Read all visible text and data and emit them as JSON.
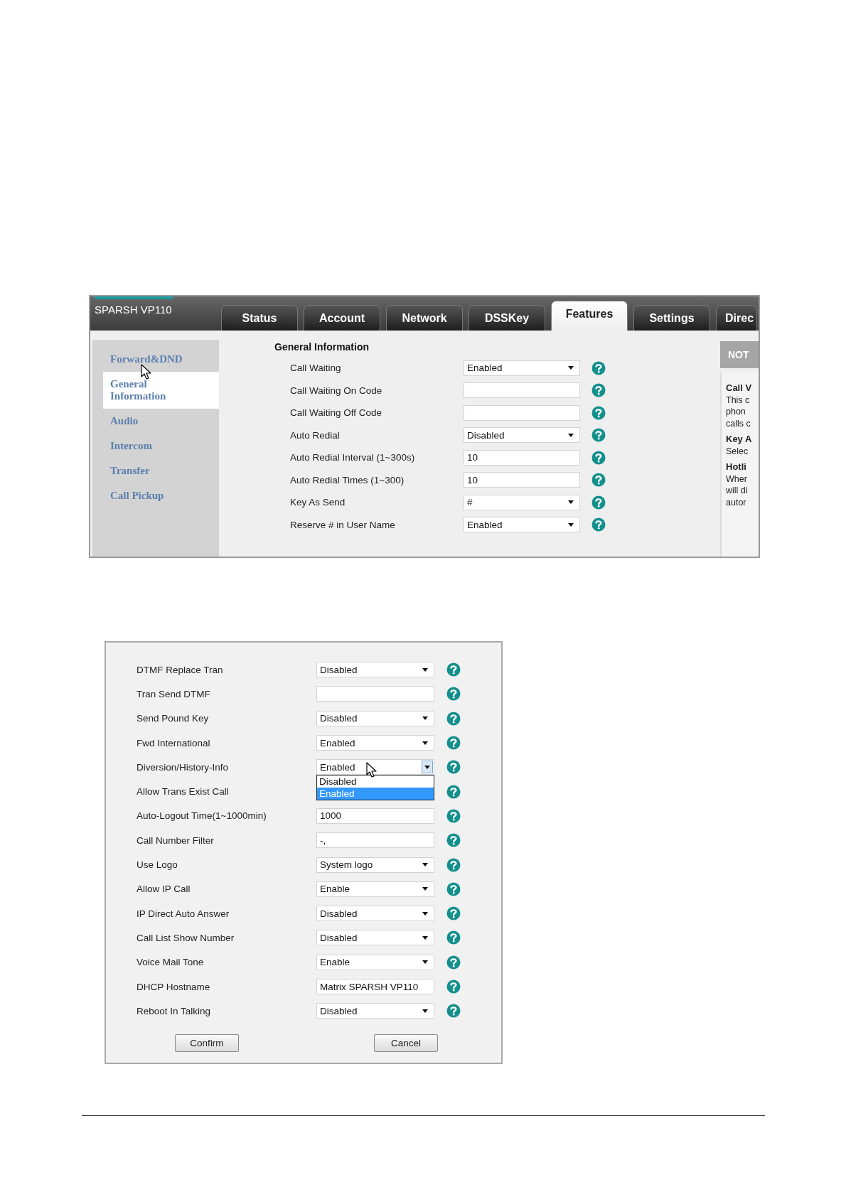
{
  "screen1": {
    "model": "SPARSH VP110",
    "tabs": [
      {
        "label": "Status",
        "selected": false
      },
      {
        "label": "Account",
        "selected": false
      },
      {
        "label": "Network",
        "selected": false
      },
      {
        "label": "DSSKey",
        "selected": false
      },
      {
        "label": "Features",
        "selected": true
      },
      {
        "label": "Settings",
        "selected": false
      },
      {
        "label": "Direc",
        "selected": false
      }
    ],
    "sidebar": [
      {
        "label": "Forward&DND",
        "selected": false
      },
      {
        "label": "General Information",
        "selected": true
      },
      {
        "label": "Audio",
        "selected": false
      },
      {
        "label": "Intercom",
        "selected": false
      },
      {
        "label": "Transfer",
        "selected": false
      },
      {
        "label": "Call Pickup",
        "selected": false
      }
    ],
    "section_title": "General Information",
    "rows": [
      {
        "label": "Call Waiting",
        "kind": "select",
        "value": "Enabled",
        "expanded": false
      },
      {
        "label": "Call Waiting On Code",
        "kind": "input"
      },
      {
        "label": "Call Waiting Off Code",
        "kind": "input"
      },
      {
        "label": "Auto Redial",
        "kind": "select",
        "value": "Disabled",
        "expanded": false
      },
      {
        "label": "Auto Redial Interval (1~300s)",
        "kind": "input",
        "value": "10"
      },
      {
        "label": "Auto Redial Times (1~300)",
        "kind": "input",
        "value": "10"
      },
      {
        "label": "Key As Send",
        "kind": "select",
        "value": "#",
        "expanded": false
      },
      {
        "label": "Reserve # in User Name",
        "kind": "select",
        "value": "Enabled",
        "expanded": false
      }
    ],
    "notes": {
      "header": "NOT",
      "lines": [
        {
          "text": "Call V",
          "kind": "heading"
        },
        {
          "text": "This c",
          "kind": "body"
        },
        {
          "text": "phon",
          "kind": "body"
        },
        {
          "text": "calls c",
          "kind": "body"
        },
        {
          "text": "Key A",
          "kind": "heading"
        },
        {
          "text": "Selec",
          "kind": "body"
        },
        {
          "text": "Hotli",
          "kind": "heading"
        },
        {
          "text": "Wher",
          "kind": "body"
        },
        {
          "text": "will di",
          "kind": "body"
        },
        {
          "text": "autor",
          "kind": "body"
        }
      ]
    }
  },
  "screen2": {
    "rows": [
      {
        "label": "DTMF Replace Tran",
        "kind": "select",
        "value": "Disabled",
        "expanded": false
      },
      {
        "label": "Tran Send DTMF",
        "kind": "input"
      },
      {
        "label": "Send Pound Key",
        "kind": "select",
        "value": "Disabled",
        "expanded": false
      },
      {
        "label": "Fwd International",
        "kind": "select",
        "value": "Enabled",
        "expanded": false
      },
      {
        "label": "Diversion/History-Info",
        "kind": "select",
        "value": "Enabled",
        "expanded": true,
        "options": [
          {
            "label": "Disabled",
            "selected": false
          },
          {
            "label": "Enabled",
            "selected": true
          }
        ]
      },
      {
        "label": "Allow Trans Exist Call"
      },
      {
        "label": "Auto-Logout Time(1~1000min)",
        "kind": "input",
        "value": "1000"
      },
      {
        "label": "Call Number Filter",
        "kind": "input",
        "value": "-,"
      },
      {
        "label": "Use Logo",
        "kind": "select",
        "value": "System logo",
        "expanded": false
      },
      {
        "label": "Allow IP Call",
        "kind": "select",
        "value": "Enable",
        "expanded": false
      },
      {
        "label": "IP Direct Auto Answer",
        "kind": "select",
        "value": "Disabled",
        "expanded": false
      },
      {
        "label": "Call List Show Number",
        "kind": "select",
        "value": "Disabled",
        "expanded": false
      },
      {
        "label": "Voice Mail Tone",
        "kind": "select",
        "value": "Enable",
        "expanded": false
      },
      {
        "label": "DHCP Hostname",
        "kind": "input",
        "value": "Matrix SPARSH VP110"
      },
      {
        "label": "Reboot In Talking",
        "kind": "select",
        "value": "Disabled",
        "expanded": false
      }
    ],
    "buttons": [
      "Confirm",
      "Cancel"
    ]
  }
}
